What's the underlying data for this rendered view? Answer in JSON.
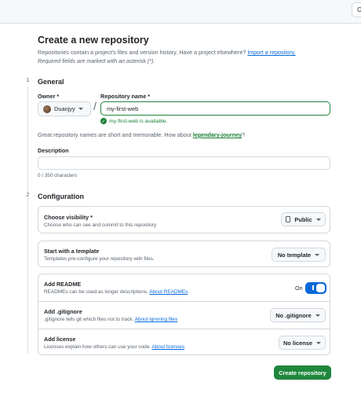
{
  "header": {
    "corner_button": "C"
  },
  "page": {
    "title": "Create a new repository",
    "intro_text": "Repositories contain a project's files and version history. Have a project elsewhere? ",
    "import_link": "Import a repository.",
    "required_note": "Required fields are marked with an asterisk (*)."
  },
  "general": {
    "step": "1",
    "heading": "General",
    "owner_label": "Owner *",
    "owner_value": "Duanjyy",
    "repo_label": "Repository name *",
    "repo_value": "my-first-web",
    "availability": "my-first-web is available.",
    "suggest_prefix": "Great repository names are short and memorable. How about ",
    "suggest_name": "legendary-journey",
    "suggest_suffix": "?",
    "description_label": "Description",
    "description_value": "",
    "char_count": "0 / 350 characters"
  },
  "configuration": {
    "step": "2",
    "heading": "Configuration",
    "visibility": {
      "title": "Choose visibility *",
      "subtitle": "Choose who can see and commit to this repository",
      "value": "Public"
    },
    "template": {
      "title": "Start with a template",
      "subtitle": "Templates pre-configure your repository with files.",
      "value": "No template"
    },
    "readme": {
      "title": "Add README",
      "subtitle_prefix": "READMEs can be used as longer descriptions. ",
      "link": "About READMEs",
      "toggle_label": "On",
      "toggle_on": true
    },
    "gitignore": {
      "title": "Add .gitignore",
      "subtitle_prefix": ".gitignore tells git which files not to track. ",
      "link": "About ignoring files",
      "value": "No .gitignore"
    },
    "license": {
      "title": "Add license",
      "subtitle_prefix": "Licenses explain how others can use your code. ",
      "link": "About licenses",
      "value": "No license"
    }
  },
  "actions": {
    "create_label": "Create repository"
  },
  "colors": {
    "primary_green": "#1f883d",
    "link_blue": "#0969da",
    "toggle_blue": "#0969da"
  }
}
